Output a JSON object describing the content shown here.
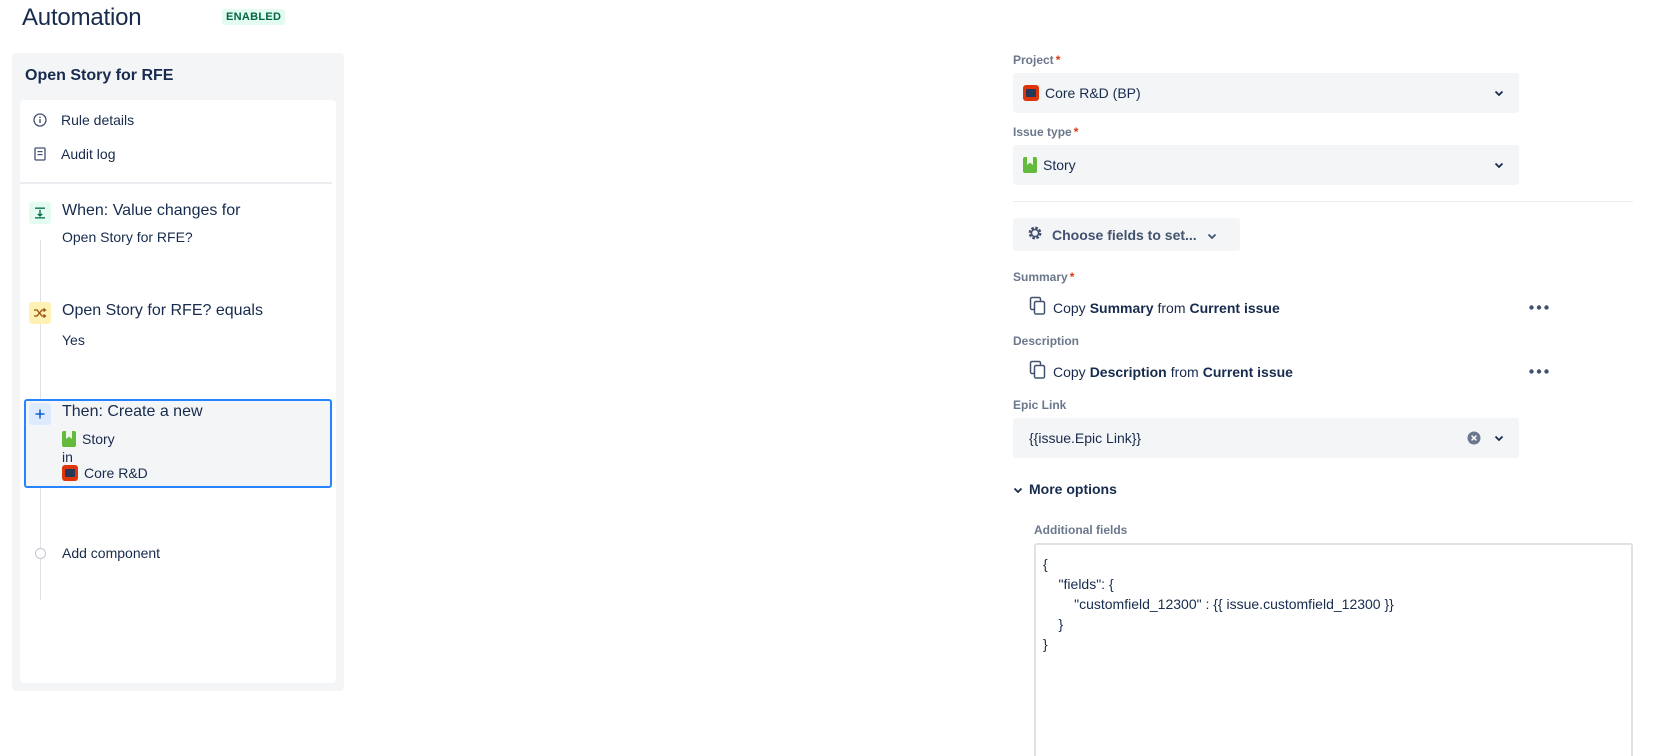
{
  "header": {
    "title": "Automation",
    "status": "ENABLED"
  },
  "rule": {
    "name": "Open Story for RFE",
    "menu": [
      {
        "label": "Rule details",
        "icon": "info-icon"
      },
      {
        "label": "Audit log",
        "icon": "audit-log-icon"
      }
    ],
    "trigger": {
      "title": "When: Value changes for",
      "subtitle": "Open Story for RFE?",
      "icon": "trigger-icon"
    },
    "condition": {
      "title": "Open Story for RFE? equals",
      "subtitle": "Yes",
      "icon": "condition-shuffle-icon"
    },
    "action": {
      "title": "Then: Create a new",
      "issue_type": "Story",
      "connector": "in",
      "project": "Core R&D",
      "icon": "plus-icon"
    },
    "add_component": "Add component"
  },
  "form": {
    "project": {
      "label": "Project",
      "value": "Core R&D (BP)"
    },
    "issue_type": {
      "label": "Issue type",
      "value": "Story"
    },
    "choose_fields": "Choose fields to set...",
    "summary": {
      "label": "Summary",
      "copy": "Copy",
      "field": "Summary",
      "from": "from",
      "source": "Current issue"
    },
    "description": {
      "label": "Description",
      "copy": "Copy",
      "field": "Description",
      "from": "from",
      "source": "Current issue"
    },
    "epic_link": {
      "label": "Epic Link",
      "value": "{{issue.Epic Link}}"
    },
    "more_options": "More options",
    "additional_fields": {
      "label": "Additional fields",
      "value": "{\n    \"fields\": {\n        \"customfield_12300\" : {{ issue.customfield_12300 }}\n    }\n}"
    }
  },
  "colors": {
    "accent": "#2684ff",
    "enabled_bg": "#e3fcef",
    "enabled_text": "#006644",
    "required": "#de350b",
    "story": "#63ba3c"
  }
}
